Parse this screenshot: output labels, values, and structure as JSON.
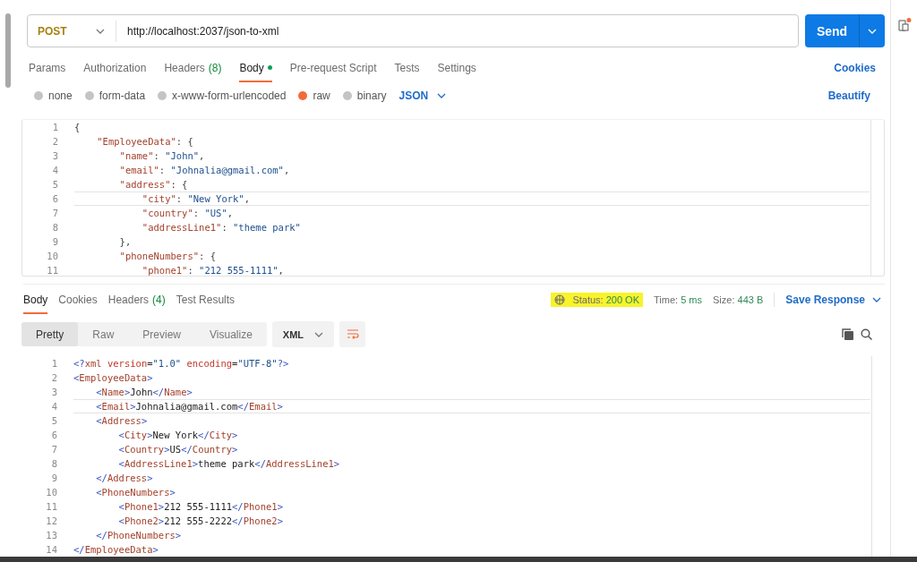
{
  "request": {
    "method": "POST",
    "url": "http://localhost:2037/json-to-xml",
    "send": "Send"
  },
  "request_tabs": [
    {
      "label": "Params",
      "selected": false
    },
    {
      "label": "Authorization",
      "selected": false
    },
    {
      "label": "Headers",
      "count": "(8)",
      "selected": false
    },
    {
      "label": "Body",
      "selected": true,
      "dot": true
    },
    {
      "label": "Pre-request Script",
      "selected": false
    },
    {
      "label": "Tests",
      "selected": false
    },
    {
      "label": "Settings",
      "selected": false
    }
  ],
  "cookies_link": "Cookies",
  "body_types": [
    {
      "label": "none",
      "selected": false
    },
    {
      "label": "form-data",
      "selected": false
    },
    {
      "label": "x-www-form-urlencoded",
      "selected": false
    },
    {
      "label": "raw",
      "selected": true
    },
    {
      "label": "binary",
      "selected": false
    }
  ],
  "body_format": "JSON",
  "beautify": "Beautify",
  "request_body": [
    {
      "number": "1",
      "active": false,
      "tokens": [
        {
          "kind": "punct",
          "text": "{"
        }
      ]
    },
    {
      "number": "2",
      "active": false,
      "tokens": [
        {
          "kind": "key",
          "text": "    \"EmployeeData\""
        },
        {
          "kind": "punct",
          "text": ": {"
        }
      ]
    },
    {
      "number": "3",
      "active": false,
      "tokens": [
        {
          "kind": "key",
          "text": "        \"name\""
        },
        {
          "kind": "punct",
          "text": ": "
        },
        {
          "kind": "string",
          "text": "\"John\""
        },
        {
          "kind": "punct",
          "text": ","
        }
      ]
    },
    {
      "number": "4",
      "active": false,
      "tokens": [
        {
          "kind": "key",
          "text": "        \"email\""
        },
        {
          "kind": "punct",
          "text": ": "
        },
        {
          "kind": "string",
          "text": "\"Johnalia@gmail.com\""
        },
        {
          "kind": "punct",
          "text": ","
        }
      ]
    },
    {
      "number": "5",
      "active": false,
      "tokens": [
        {
          "kind": "key",
          "text": "        \"address\""
        },
        {
          "kind": "punct",
          "text": ": {"
        }
      ]
    },
    {
      "number": "6",
      "active": true,
      "tokens": [
        {
          "kind": "key",
          "text": "            \"city\""
        },
        {
          "kind": "punct",
          "text": ": "
        },
        {
          "kind": "string",
          "text": "\"New York\""
        },
        {
          "kind": "punct",
          "text": ","
        }
      ]
    },
    {
      "number": "7",
      "active": false,
      "tokens": [
        {
          "kind": "key",
          "text": "            \"country\""
        },
        {
          "kind": "punct",
          "text": ": "
        },
        {
          "kind": "string",
          "text": "\"US\""
        },
        {
          "kind": "punct",
          "text": ","
        }
      ]
    },
    {
      "number": "8",
      "active": false,
      "tokens": [
        {
          "kind": "key",
          "text": "            \"addressLine1\""
        },
        {
          "kind": "punct",
          "text": ": "
        },
        {
          "kind": "string",
          "text": "\"theme park\""
        }
      ]
    },
    {
      "number": "9",
      "active": false,
      "tokens": [
        {
          "kind": "punct",
          "text": "        },"
        }
      ]
    },
    {
      "number": "10",
      "active": false,
      "tokens": [
        {
          "kind": "key",
          "text": "        \"phoneNumbers\""
        },
        {
          "kind": "punct",
          "text": ": {"
        }
      ]
    },
    {
      "number": "11",
      "active": false,
      "tokens": [
        {
          "kind": "key",
          "text": "            \"phone1\""
        },
        {
          "kind": "punct",
          "text": ": "
        },
        {
          "kind": "string",
          "text": "\"212 555-1111\""
        },
        {
          "kind": "punct",
          "text": ","
        }
      ]
    }
  ],
  "response_tabs": [
    {
      "label": "Body",
      "selected": true
    },
    {
      "label": "Cookies",
      "selected": false
    },
    {
      "label": "Headers",
      "count": "(4)",
      "selected": false
    },
    {
      "label": "Test Results",
      "selected": false
    }
  ],
  "response_meta": [
    {
      "label": "Status:",
      "value": "200 OK",
      "highlighted": true
    },
    {
      "label": "Time:",
      "value": "5 ms",
      "highlighted": false
    },
    {
      "label": "Size:",
      "value": "443 B",
      "highlighted": false
    }
  ],
  "save_response": "Save Response",
  "view_modes": [
    {
      "label": "Pretty",
      "selected": true
    },
    {
      "label": "Raw",
      "selected": false
    },
    {
      "label": "Preview",
      "selected": false
    },
    {
      "label": "Visualize",
      "selected": false
    }
  ],
  "response_format": "XML",
  "response_body": [
    {
      "number": "1",
      "active": false,
      "tokens": [
        {
          "kind": "bracket",
          "text": "<?"
        },
        {
          "kind": "tag",
          "text": "xml"
        },
        {
          "kind": "attr",
          "text": " version"
        },
        {
          "kind": "text",
          "text": "="
        },
        {
          "kind": "value",
          "text": "\"1.0\""
        },
        {
          "kind": "attr",
          "text": " encoding"
        },
        {
          "kind": "text",
          "text": "="
        },
        {
          "kind": "value",
          "text": "\"UTF-8\""
        },
        {
          "kind": "bracket",
          "text": "?>"
        }
      ]
    },
    {
      "number": "2",
      "active": false,
      "tokens": [
        {
          "kind": "bracket",
          "text": "<"
        },
        {
          "kind": "tag",
          "text": "EmployeeData"
        },
        {
          "kind": "bracket",
          "text": ">"
        }
      ]
    },
    {
      "number": "3",
      "active": false,
      "tokens": [
        {
          "kind": "bracket",
          "text": "    <"
        },
        {
          "kind": "tag",
          "text": "Name"
        },
        {
          "kind": "bracket",
          "text": ">"
        },
        {
          "kind": "text",
          "text": "John"
        },
        {
          "kind": "bracket",
          "text": "</"
        },
        {
          "kind": "tag",
          "text": "Name"
        },
        {
          "kind": "bracket",
          "text": ">"
        }
      ]
    },
    {
      "number": "4",
      "active": true,
      "tokens": [
        {
          "kind": "bracket",
          "text": "    <"
        },
        {
          "kind": "tag",
          "text": "Email"
        },
        {
          "kind": "bracket",
          "text": ">"
        },
        {
          "kind": "text",
          "text": "Johnalia@gmail.com"
        },
        {
          "kind": "bracket",
          "text": "</"
        },
        {
          "kind": "tag",
          "text": "Email"
        },
        {
          "kind": "bracket",
          "text": ">"
        }
      ]
    },
    {
      "number": "5",
      "active": false,
      "tokens": [
        {
          "kind": "bracket",
          "text": "    <"
        },
        {
          "kind": "tag",
          "text": "Address"
        },
        {
          "kind": "bracket",
          "text": ">"
        }
      ]
    },
    {
      "number": "6",
      "active": false,
      "tokens": [
        {
          "kind": "bracket",
          "text": "        <"
        },
        {
          "kind": "tag",
          "text": "City"
        },
        {
          "kind": "bracket",
          "text": ">"
        },
        {
          "kind": "text",
          "text": "New York"
        },
        {
          "kind": "bracket",
          "text": "</"
        },
        {
          "kind": "tag",
          "text": "City"
        },
        {
          "kind": "bracket",
          "text": ">"
        }
      ]
    },
    {
      "number": "7",
      "active": false,
      "tokens": [
        {
          "kind": "bracket",
          "text": "        <"
        },
        {
          "kind": "tag",
          "text": "Country"
        },
        {
          "kind": "bracket",
          "text": ">"
        },
        {
          "kind": "text",
          "text": "US"
        },
        {
          "kind": "bracket",
          "text": "</"
        },
        {
          "kind": "tag",
          "text": "Country"
        },
        {
          "kind": "bracket",
          "text": ">"
        }
      ]
    },
    {
      "number": "8",
      "active": false,
      "tokens": [
        {
          "kind": "bracket",
          "text": "        <"
        },
        {
          "kind": "tag",
          "text": "AddressLine1"
        },
        {
          "kind": "bracket",
          "text": ">"
        },
        {
          "kind": "text",
          "text": "theme park"
        },
        {
          "kind": "bracket",
          "text": "</"
        },
        {
          "kind": "tag",
          "text": "AddressLine1"
        },
        {
          "kind": "bracket",
          "text": ">"
        }
      ]
    },
    {
      "number": "9",
      "active": false,
      "tokens": [
        {
          "kind": "bracket",
          "text": "    </"
        },
        {
          "kind": "tag",
          "text": "Address"
        },
        {
          "kind": "bracket",
          "text": ">"
        }
      ]
    },
    {
      "number": "10",
      "active": false,
      "tokens": [
        {
          "kind": "bracket",
          "text": "    <"
        },
        {
          "kind": "tag",
          "text": "PhoneNumbers"
        },
        {
          "kind": "bracket",
          "text": ">"
        }
      ]
    },
    {
      "number": "11",
      "active": false,
      "tokens": [
        {
          "kind": "bracket",
          "text": "        <"
        },
        {
          "kind": "tag",
          "text": "Phone1"
        },
        {
          "kind": "bracket",
          "text": ">"
        },
        {
          "kind": "text",
          "text": "212 555-1111"
        },
        {
          "kind": "bracket",
          "text": "</"
        },
        {
          "kind": "tag",
          "text": "Phone1"
        },
        {
          "kind": "bracket",
          "text": ">"
        }
      ]
    },
    {
      "number": "12",
      "active": false,
      "tokens": [
        {
          "kind": "bracket",
          "text": "        <"
        },
        {
          "kind": "tag",
          "text": "Phone2"
        },
        {
          "kind": "bracket",
          "text": ">"
        },
        {
          "kind": "text",
          "text": "212 555-2222"
        },
        {
          "kind": "bracket",
          "text": "</"
        },
        {
          "kind": "tag",
          "text": "Phone2"
        },
        {
          "kind": "bracket",
          "text": ">"
        }
      ]
    },
    {
      "number": "13",
      "active": false,
      "tokens": [
        {
          "kind": "bracket",
          "text": "    </"
        },
        {
          "kind": "tag",
          "text": "PhoneNumbers"
        },
        {
          "kind": "bracket",
          "text": ">"
        }
      ]
    },
    {
      "number": "14",
      "active": false,
      "tokens": [
        {
          "kind": "bracket",
          "text": "</"
        },
        {
          "kind": "tag",
          "text": "EmployeeData"
        },
        {
          "kind": "bracket",
          "text": ">"
        }
      ]
    }
  ]
}
